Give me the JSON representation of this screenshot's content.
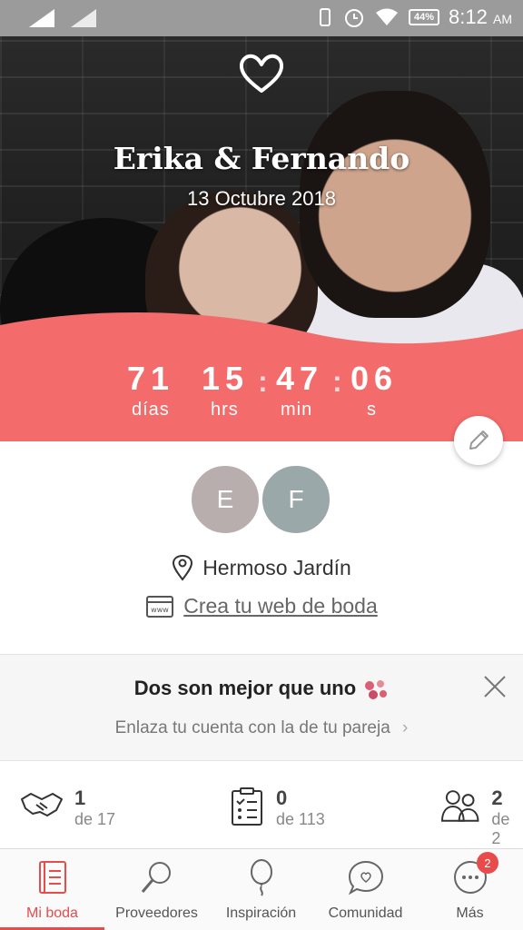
{
  "status_bar": {
    "battery": "44%",
    "time": "8:12",
    "ampm": "AM"
  },
  "hero": {
    "couple_name": "Erika & Fernando",
    "wedding_date": "13 Octubre 2018",
    "countdown": {
      "days": "71",
      "hours": "15",
      "minutes": "47",
      "seconds": "06",
      "days_label": "días",
      "hours_label": "hrs",
      "minutes_label": "min",
      "seconds_label": "s"
    }
  },
  "profile": {
    "avatar_1": "E",
    "avatar_2": "F",
    "venue": "Hermoso Jardín",
    "web_link": "Crea tu web de boda"
  },
  "banner": {
    "title": "Dos son mejor que uno",
    "subtitle": "Enlaza tu cuenta con la de tu pareja"
  },
  "stats": [
    {
      "value": "1",
      "of": "de 17"
    },
    {
      "value": "0",
      "of": "de 113"
    },
    {
      "value": "2",
      "of": "de 2"
    }
  ],
  "nav": {
    "items": [
      {
        "label": "Mi boda"
      },
      {
        "label": "Proveedores"
      },
      {
        "label": "Inspiración"
      },
      {
        "label": "Comunidad"
      },
      {
        "label": "Más"
      }
    ],
    "more_badge": "2"
  },
  "colors": {
    "accent": "#f36b6b",
    "active": "#e84b4b"
  }
}
